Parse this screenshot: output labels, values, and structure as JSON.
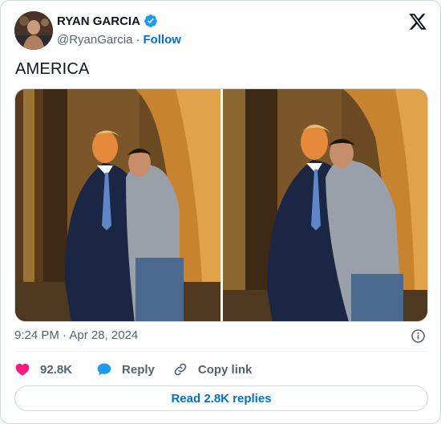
{
  "author": {
    "name": "RYAN GARCIA",
    "handle": "@RyanGarcia",
    "separator": "·",
    "follow_label": "Follow"
  },
  "tweet": {
    "text": "AMERICA",
    "timestamp": "9:24 PM · Apr 28, 2024"
  },
  "actions": {
    "likes_count": "92.8K",
    "reply_label": "Reply",
    "copy_link_label": "Copy link"
  },
  "read_replies_label": "Read 2.8K replies",
  "colors": {
    "accent": "#006fd6",
    "verified": "#1d9bf0",
    "like": "#f91880",
    "reply_bubble": "#1d9bf0",
    "muted_text": "#536471"
  },
  "icons": [
    "verified-badge-icon",
    "x-logo-icon",
    "info-icon",
    "heart-icon",
    "reply-icon",
    "link-icon"
  ]
}
